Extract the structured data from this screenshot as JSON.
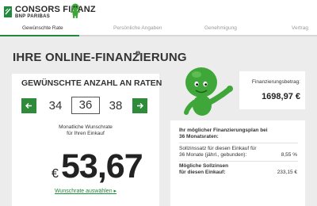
{
  "brand": {
    "name": "CONSORS FINANZ",
    "sub": "BNP PARIBAS",
    "accent": "#1f8a3b",
    "button_color": "#2e8b3a",
    "mascot_color": "#3fa73a"
  },
  "steps": [
    {
      "label": "Gewünschte Rate",
      "active": true
    },
    {
      "label": "Persönliche Angaben",
      "active": false
    },
    {
      "label": "Genehmigung",
      "active": false
    },
    {
      "label": "Vertrag",
      "active": false
    }
  ],
  "page": {
    "title": "IHRE ONLINE-FINANZIERUNG",
    "info_marker": "1"
  },
  "rates": {
    "title": "GEWÜNSCHTE ANZAHL AN RATEN",
    "prev_icon": "arrow-left-icon",
    "next_icon": "arrow-right-icon",
    "options": [
      "34",
      "36",
      "38"
    ],
    "selected": "36"
  },
  "wunschrate": {
    "label_line1": "Monatliche Wunschrate",
    "label_line2": "für Ihren Einkauf",
    "currency": "€",
    "amount": "53,67",
    "link": "Wunschrate auswählen ▸"
  },
  "financing": {
    "label": "Finanzierungsbetrag:",
    "value": "1698,97 €"
  },
  "plan": {
    "heading_line1": "Ihr möglicher Finanzierungsplan bei",
    "heading_line2": "36 Monatsraten:",
    "rows": [
      {
        "label_line1": "Sollzinssatz für diesen Einkauf für",
        "label_line2": "36 Monate (jährl., gebunden):",
        "value": "8,55 %",
        "bold": false
      },
      {
        "label_line1": "Mögliche Sollzinsen",
        "label_line2": "für diesen Einkauf:",
        "value": "233,15 €",
        "bold": true
      }
    ]
  }
}
